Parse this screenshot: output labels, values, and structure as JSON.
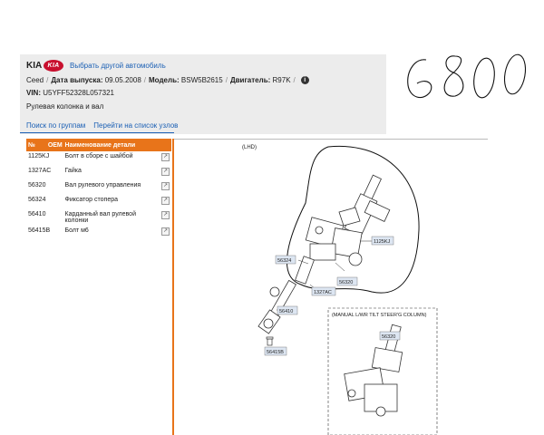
{
  "header": {
    "brand": "KIA",
    "logo_text": "KIA",
    "change_car_link": "Выбрать другой автомобиль",
    "model": "Ceed",
    "release_date_label": "Дата выпуска:",
    "release_date": "09.05.2008",
    "model_label": "Модель:",
    "model_code": "BSW5B2615",
    "engine_label": "Двигатель:",
    "engine_code": "R97K",
    "vin_label": "VIN:",
    "vin": "U5YFF52328L057321",
    "section_title": "Рулевая колонка и вал"
  },
  "nav": {
    "search_by_groups": "Поиск по группам",
    "go_to_nodes": "Перейти на список узлов"
  },
  "table": {
    "headers": [
      "№",
      "OEM",
      "Наименование детали"
    ],
    "rows": [
      {
        "num": "1125KJ",
        "name": "Болт в сборе с шайбой"
      },
      {
        "num": "1327AC",
        "name": "Гайка"
      },
      {
        "num": "56320",
        "name": "Вал рулевого управления"
      },
      {
        "num": "56324",
        "name": "Фиксатор стопера"
      },
      {
        "num": "56410",
        "name": "Карданный вал рулевой колонки"
      },
      {
        "num": "56415B",
        "name": "Болт м6"
      }
    ]
  },
  "diagram": {
    "lhd_label": "(LHD)",
    "manual_label": "(MANUAL L/WR TILT STEER'G COLUMN)",
    "callouts": {
      "c1125kj": "1125KJ",
      "c56324": "56324",
      "c56320a": "56320",
      "c1327ac": "1327AC",
      "c56410": "56410",
      "c56415b": "56415B",
      "c56320b": "56320"
    }
  },
  "handwritten_note": "6800",
  "colors": {
    "accent": "#e8741a",
    "link": "#1a5fb4",
    "header_bg": "#ececec",
    "kia_red": "#c8102e"
  }
}
